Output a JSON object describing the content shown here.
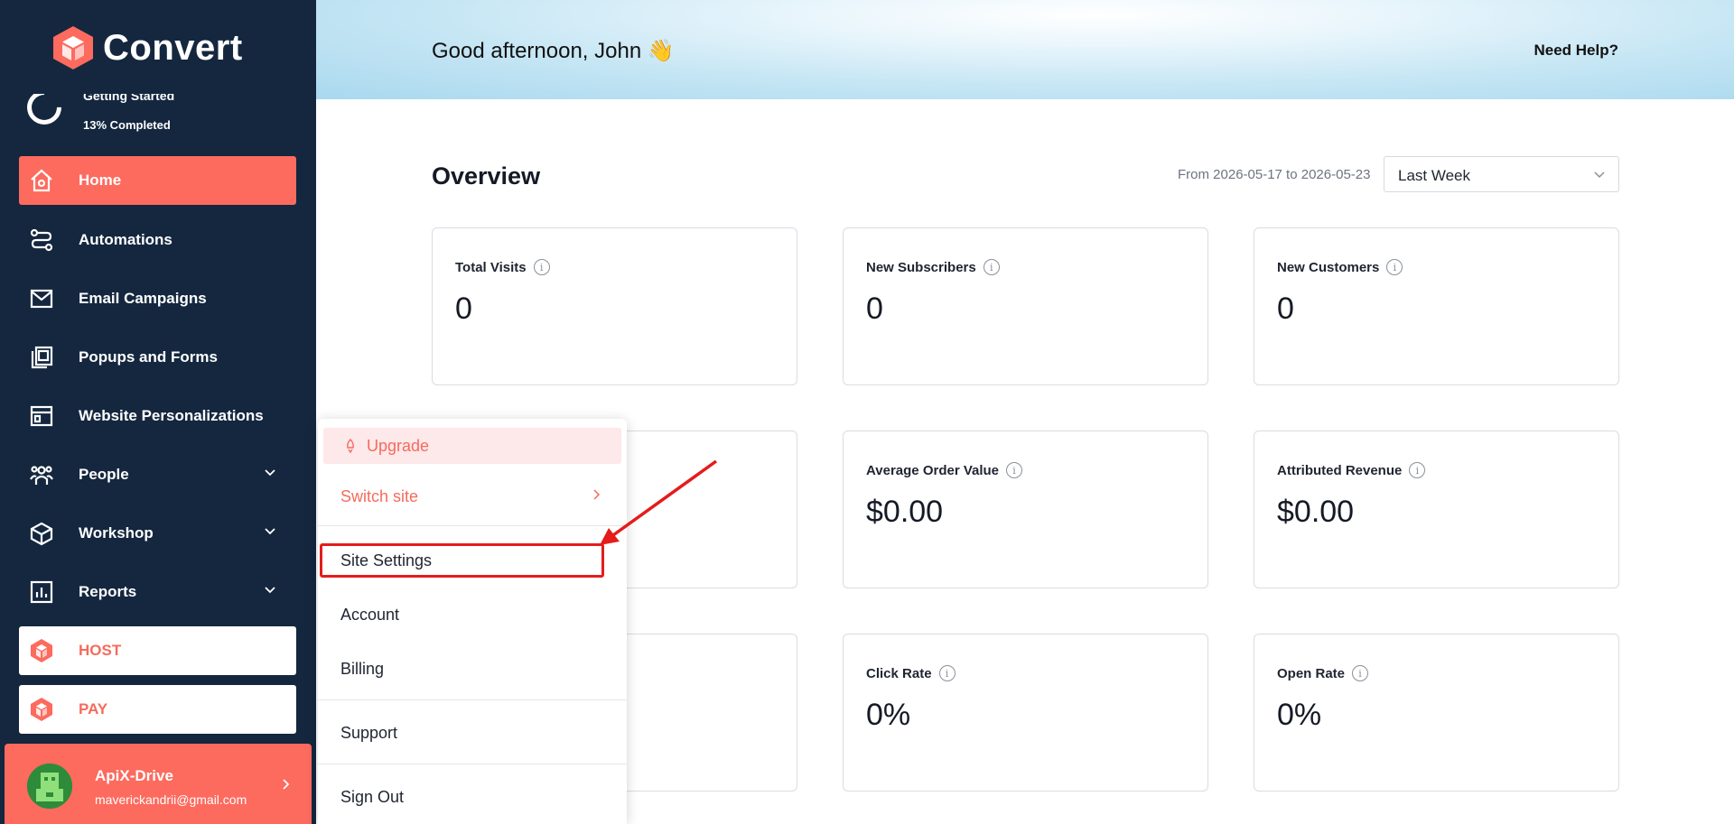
{
  "app": {
    "name": "Convert"
  },
  "progress": {
    "title": "Getting Started",
    "percent_label": "13% Completed",
    "value": 0.13
  },
  "sidebar": {
    "items": [
      {
        "label": "Home",
        "icon": "home-icon",
        "active": true
      },
      {
        "label": "Automations",
        "icon": "automations-icon"
      },
      {
        "label": "Email Campaigns",
        "icon": "mail-icon"
      },
      {
        "label": "Popups and Forms",
        "icon": "popups-icon"
      },
      {
        "label": "Website Personalizations",
        "icon": "browser-icon"
      },
      {
        "label": "People",
        "icon": "people-icon",
        "expandable": true
      },
      {
        "label": "Workshop",
        "icon": "cube-icon",
        "expandable": true
      },
      {
        "label": "Reports",
        "icon": "chart-icon",
        "expandable": true
      }
    ],
    "pills": [
      {
        "label": "HOST",
        "icon": "convert-logo-icon"
      },
      {
        "label": "PAY",
        "icon": "convert-logo-icon"
      }
    ],
    "user": {
      "name": "ApiX-Drive",
      "email": "maverickandrii@gmail.com"
    }
  },
  "header": {
    "greeting": "Good afternoon, John 👋",
    "help": "Need Help?"
  },
  "overview": {
    "title": "Overview",
    "date_range": "From 2026-05-17 to 2026-05-23",
    "period": "Last Week",
    "cards": [
      {
        "label": "Total Visits",
        "value": "0"
      },
      {
        "label": "New Subscribers",
        "value": "0"
      },
      {
        "label": "New Customers",
        "value": "0"
      },
      {
        "label": "Average Order Value",
        "value": "$0.00"
      },
      {
        "label": "Attributed Revenue",
        "value": "$0.00"
      },
      {
        "label": "Click Rate",
        "value": "0%"
      },
      {
        "label": "Open Rate",
        "value": "0%"
      }
    ]
  },
  "menu": {
    "upgrade": "Upgrade",
    "switch_site": "Switch site",
    "site_settings": "Site Settings",
    "account": "Account",
    "billing": "Billing",
    "support": "Support",
    "sign_out": "Sign Out"
  },
  "colors": {
    "sidebar": "#14273f",
    "accent": "#fd6a5e",
    "highlight": "#e41c1c"
  }
}
